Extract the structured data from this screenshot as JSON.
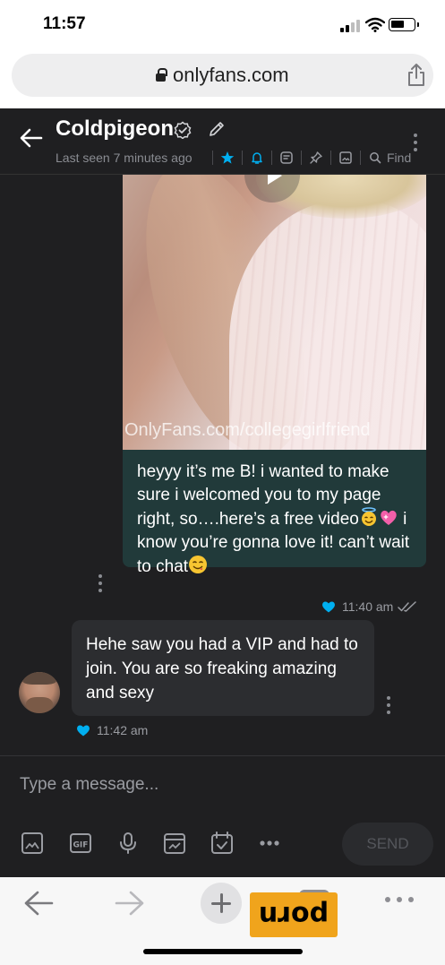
{
  "status_bar": {
    "time": "11:57"
  },
  "browser": {
    "url": "onlyfans.com"
  },
  "chat_header": {
    "contact_name": "Coldpigeon",
    "last_seen": "Last seen 7 minutes ago",
    "find_label": "Find",
    "icons": [
      "star-icon",
      "bell-icon",
      "note-icon",
      "pin-icon",
      "gallery-icon",
      "search-icon"
    ]
  },
  "messages": [
    {
      "direction": "outgoing",
      "watermark": "OnlyFans.com/collegegirlfriend",
      "text_parts": [
        "heyyy it’s me B! i wanted to make sure i welcomed you to my page right, so….here’s a free video",
        " i know you’re gonna love it! can’t wait to chat"
      ],
      "time": "11:40 am"
    },
    {
      "direction": "incoming",
      "text": "Hehe saw you had a VIP and had to join. You are so freaking amazing and sexy",
      "time": "11:42 am"
    }
  ],
  "composer": {
    "placeholder": "Type a message...",
    "send_label": "SEND",
    "tools": [
      "image-icon",
      "gif-icon",
      "microphone-icon",
      "vault-icon",
      "schedule-icon",
      "more-icon"
    ]
  },
  "watermark_brand": "porn",
  "colors": {
    "app_bg": "#1f1f21",
    "accent": "#00aff0",
    "outgoing_bubble": "#213a3a",
    "incoming_bubble": "#2c2d30",
    "brand_badge": "#f0a41c"
  }
}
